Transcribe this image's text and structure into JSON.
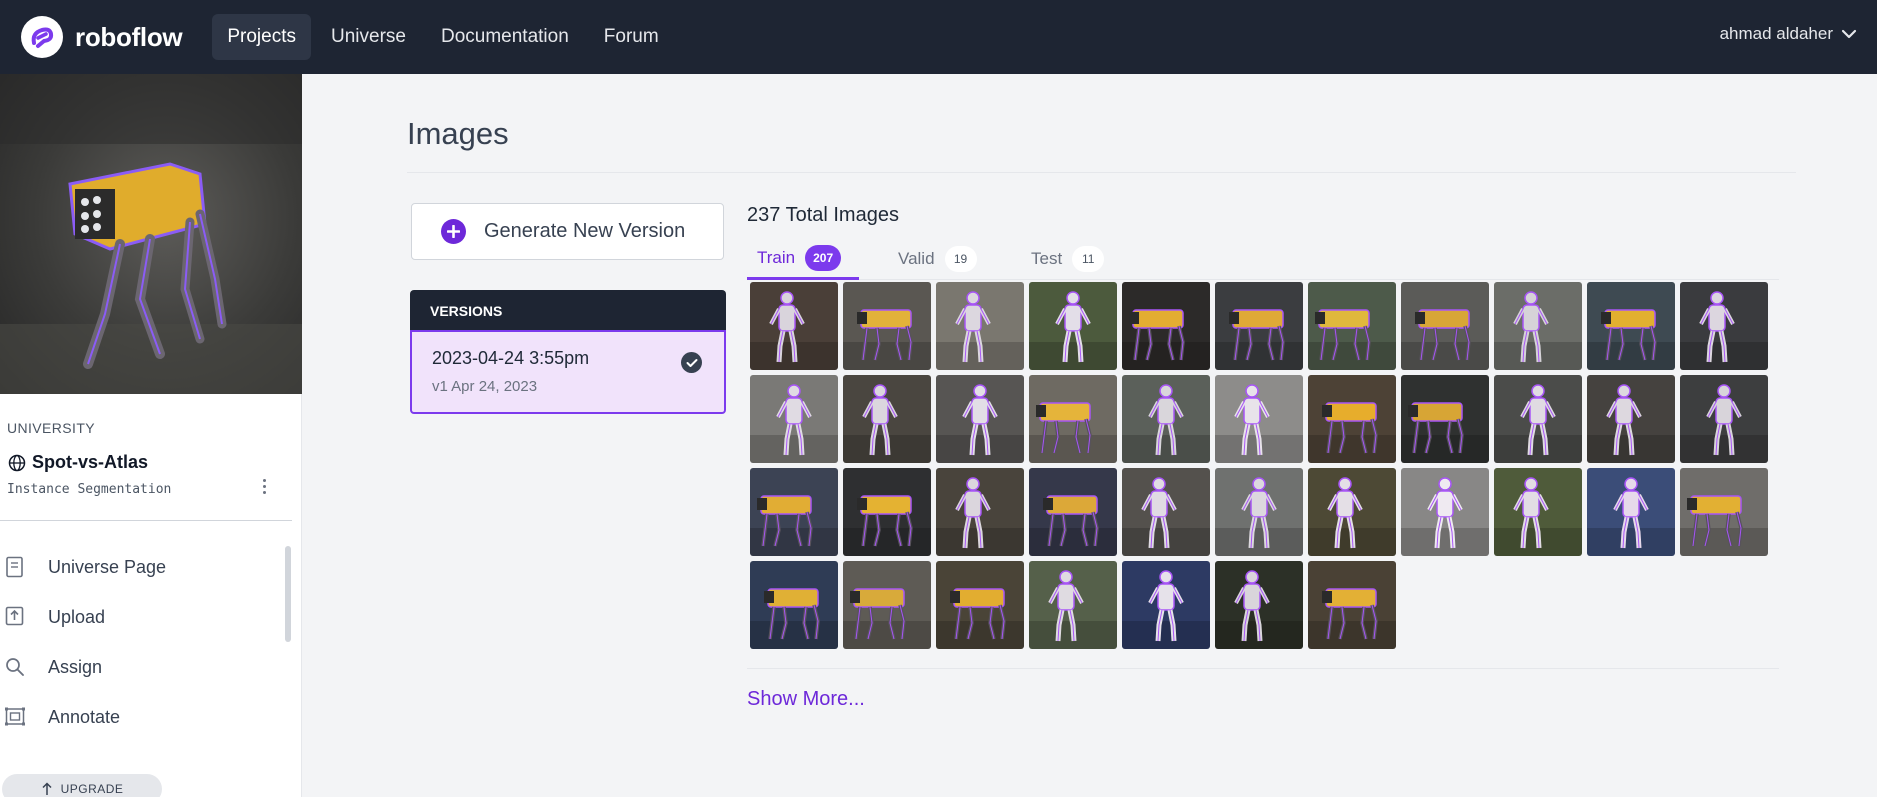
{
  "app": {
    "logo_text": "roboflow",
    "brand_color": "#7c3aed",
    "nav_bg": "#1e2533"
  },
  "nav": {
    "links": [
      {
        "label": "Projects",
        "active": true
      },
      {
        "label": "Universe",
        "active": false
      },
      {
        "label": "Documentation",
        "active": false
      },
      {
        "label": "Forum",
        "active": false
      }
    ],
    "user_name": "ahmad aldaher"
  },
  "sidebar": {
    "workspace": "UNIVERSITY",
    "project_name": "Spot-vs-Atlas",
    "project_type": "Instance Segmentation",
    "items": [
      {
        "label": "Universe Page",
        "icon": "book-icon"
      },
      {
        "label": "Upload",
        "icon": "upload-icon"
      },
      {
        "label": "Assign",
        "icon": "search-icon"
      },
      {
        "label": "Annotate",
        "icon": "annotate-icon"
      }
    ],
    "upgrade_label": "UPGRADE",
    "upgrade_icon": "arrow-up-icon"
  },
  "main": {
    "page_title": "Images",
    "generate_label": "Generate New Version",
    "versions_header": "VERSIONS",
    "version": {
      "title": "2023-04-24 3:55pm",
      "subtitle": "v1 Apr 24, 2023",
      "selected": true
    },
    "total_images": "237 Total Images",
    "tabs": [
      {
        "label": "Train",
        "count": "207",
        "active": true
      },
      {
        "label": "Valid",
        "count": "19",
        "active": false
      },
      {
        "label": "Test",
        "count": "11",
        "active": false
      }
    ],
    "show_more": "Show More..."
  },
  "thumbnails": [
    {
      "subject": "atlas",
      "bg": "#4a3f38",
      "body": "#d9d4dc"
    },
    {
      "subject": "spot",
      "bg": "#5a5752",
      "body": "#e2b23a"
    },
    {
      "subject": "atlas",
      "bg": "#7a776f",
      "body": "#dcd7df"
    },
    {
      "subject": "atlas",
      "bg": "#4c5a3d",
      "body": "#e3dee8"
    },
    {
      "subject": "spot",
      "bg": "#2c2a29",
      "body": "#e3ad32"
    },
    {
      "subject": "spot",
      "bg": "#3b3d40",
      "body": "#dfa936"
    },
    {
      "subject": "spot",
      "bg": "#4d5a4a",
      "body": "#e0b83c"
    },
    {
      "subject": "spot",
      "bg": "#5b5b58",
      "body": "#d8a636"
    },
    {
      "subject": "atlas",
      "bg": "#6b6d68",
      "body": "#d6d3d8"
    },
    {
      "subject": "spot",
      "bg": "#3e4a52",
      "body": "#e2b02f"
    },
    {
      "subject": "atlas",
      "bg": "#3a3b3e",
      "body": "#dcd6df"
    },
    {
      "subject": "atlas",
      "bg": "#7a7976",
      "body": "#e0dbe3"
    },
    {
      "subject": "atlas",
      "bg": "#4a4640",
      "body": "#dbd6de"
    },
    {
      "subject": "atlas",
      "bg": "#575553",
      "body": "#e2dee6"
    },
    {
      "subject": "spot",
      "bg": "#6e6a62",
      "body": "#e5b43a"
    },
    {
      "subject": "atlas",
      "bg": "#5b605a",
      "body": "#d9d6db"
    },
    {
      "subject": "atlas",
      "bg": "#8d8c8a",
      "body": "#e8e3ea"
    },
    {
      "subject": "spot",
      "bg": "#4d4236",
      "body": "#e7ad2c"
    },
    {
      "subject": "spot",
      "bg": "#2f3130",
      "body": "#d7a535"
    },
    {
      "subject": "atlas",
      "bg": "#4b4c4a",
      "body": "#e0dbe2"
    },
    {
      "subject": "atlas",
      "bg": "#45423f",
      "body": "#ddd8df"
    },
    {
      "subject": "atlas",
      "bg": "#3d3e3f",
      "body": "#d8d4da"
    },
    {
      "subject": "spot",
      "bg": "#3c4354",
      "body": "#e1ad34"
    },
    {
      "subject": "spot",
      "bg": "#2e2f31",
      "body": "#e4b232"
    },
    {
      "subject": "atlas",
      "bg": "#49443c",
      "body": "#dbd6dd"
    },
    {
      "subject": "spot",
      "bg": "#35384a",
      "body": "#dca838"
    },
    {
      "subject": "atlas",
      "bg": "#54514d",
      "body": "#e0dbe3"
    },
    {
      "subject": "atlas",
      "bg": "#6f716f",
      "body": "#dcd8de"
    },
    {
      "subject": "atlas",
      "bg": "#4d4935",
      "body": "#e4dfe6"
    },
    {
      "subject": "atlas",
      "bg": "#888786",
      "body": "#efeaf1"
    },
    {
      "subject": "atlas",
      "bg": "#4f5b3a",
      "body": "#e2dde4"
    },
    {
      "subject": "atlas",
      "bg": "#3b4d78",
      "body": "#e6d9ea"
    },
    {
      "subject": "spot",
      "bg": "#6f6d6a",
      "body": "#e2b033"
    },
    {
      "subject": "spot",
      "bg": "#2f3c55",
      "body": "#e0b035"
    },
    {
      "subject": "spot",
      "bg": "#5e5b55",
      "body": "#d8aa3a"
    },
    {
      "subject": "spot",
      "bg": "#4a4437",
      "body": "#e2ad30"
    },
    {
      "subject": "atlas",
      "bg": "#55604a",
      "body": "#dfdbe1"
    },
    {
      "subject": "atlas",
      "bg": "#2d3a63",
      "body": "#e6e2ea"
    },
    {
      "subject": "atlas",
      "bg": "#2c3027",
      "body": "#d9d5db"
    },
    {
      "subject": "spot",
      "bg": "#4a4135",
      "body": "#e3b035"
    }
  ]
}
